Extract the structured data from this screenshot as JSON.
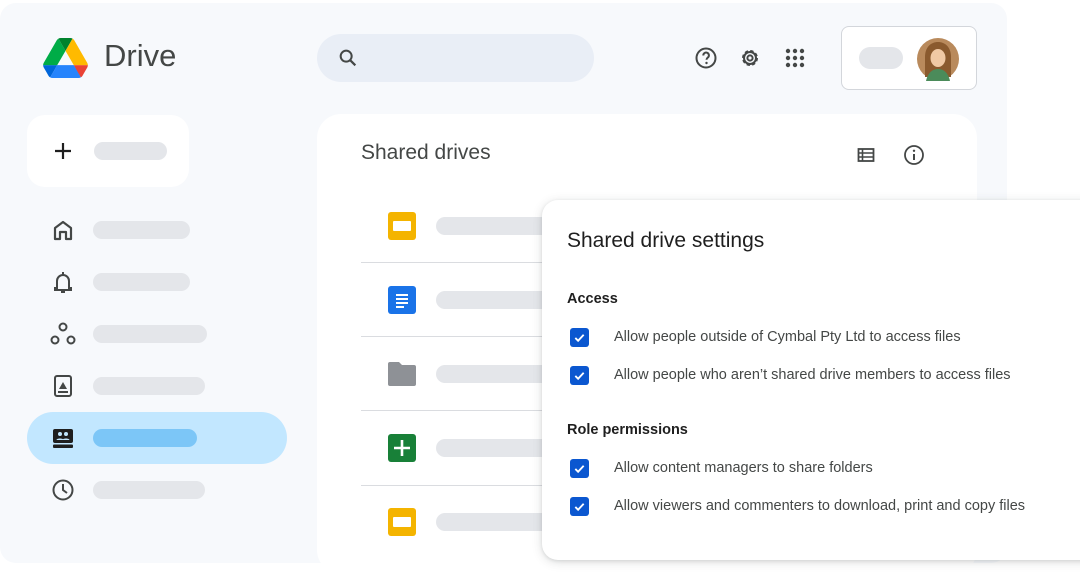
{
  "app": {
    "title": "Drive"
  },
  "header": {
    "icons": [
      "search-icon",
      "help-icon",
      "settings-icon",
      "apps-icon"
    ]
  },
  "main": {
    "title": "Shared drives",
    "file_icons": [
      "slides",
      "docs",
      "folder",
      "sheets",
      "slides"
    ]
  },
  "dialog": {
    "title": "Shared drive settings",
    "sections": [
      {
        "heading": "Access",
        "options": [
          {
            "label": "Allow people outside of Cymbal Pty Ltd to access files",
            "checked": true
          },
          {
            "label": "Allow people who aren’t shared drive members to access files",
            "checked": true
          }
        ]
      },
      {
        "heading": "Role permissions",
        "options": [
          {
            "label": "Allow content managers to share folders",
            "checked": true
          },
          {
            "label": "Allow viewers and commenters to download, print and copy files",
            "checked": true
          }
        ]
      }
    ]
  },
  "colors": {
    "accent": "#0b57d0",
    "active_nav": "#c2e7ff",
    "background": "#f7f9fc"
  }
}
